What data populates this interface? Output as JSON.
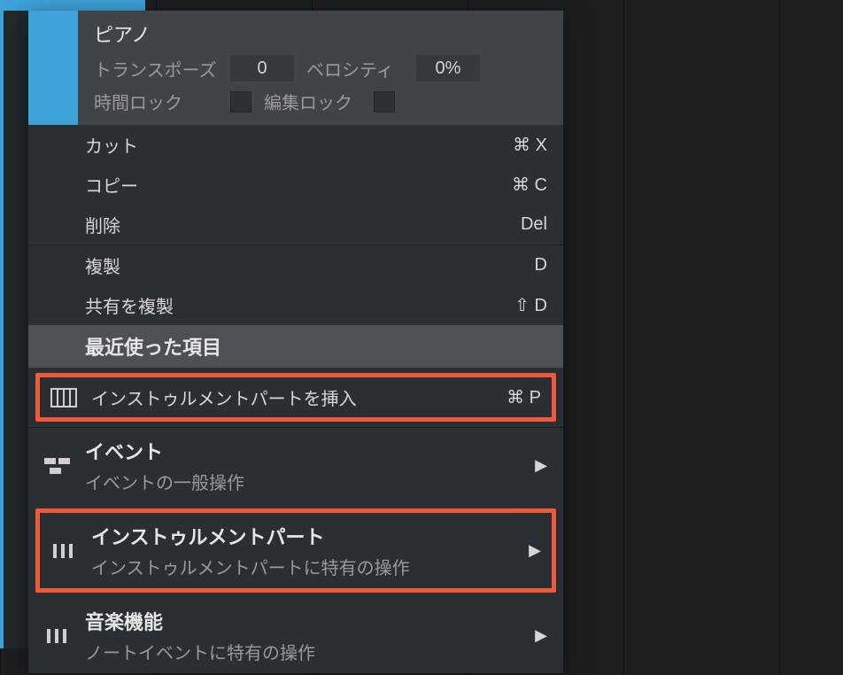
{
  "header": {
    "title": "ピアノ",
    "transpose_label": "トランスポーズ",
    "transpose_value": "0",
    "velocity_label": "ベロシティ",
    "velocity_value": "0%",
    "timelock_label": "時間ロック",
    "editlock_label": "編集ロック"
  },
  "edit": {
    "cut": {
      "label": "カット",
      "shortcut": "⌘ X"
    },
    "copy": {
      "label": "コピー",
      "shortcut": "⌘ C"
    },
    "delete": {
      "label": "削除",
      "shortcut": "Del"
    },
    "dup": {
      "label": "複製",
      "shortcut": "D"
    },
    "dupshare": {
      "label": "共有を複製",
      "shortcut": "⇧ D"
    }
  },
  "section_recent": "最近使った項目",
  "insert_part": {
    "label": "インストゥルメントパートを挿入",
    "shortcut": "⌘ P"
  },
  "sub_event": {
    "title": "イベント",
    "desc": "イベントの一般操作"
  },
  "sub_instpart": {
    "title": "インストゥルメントパート",
    "desc": "インストゥルメントパートに特有の操作"
  },
  "sub_music": {
    "title": "音楽機能",
    "desc": "ノートイベントに特有の操作"
  },
  "chevron": "▶"
}
